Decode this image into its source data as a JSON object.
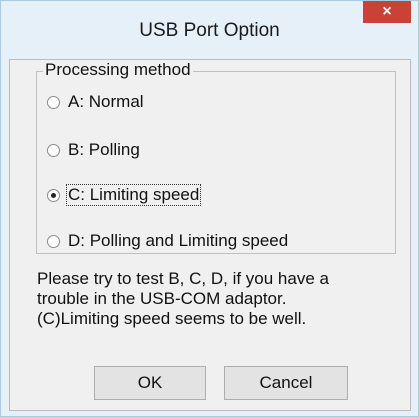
{
  "window": {
    "title": "USB Port Option",
    "close_glyph": "×"
  },
  "processing_method": {
    "legend": "Processing method",
    "options": [
      {
        "label": "A: Normal",
        "selected": false
      },
      {
        "label": "B: Polling",
        "selected": false
      },
      {
        "label": "C: Limiting speed",
        "selected": true
      },
      {
        "label": "D: Polling and Limiting speed",
        "selected": false
      }
    ]
  },
  "note": {
    "line1": "Please try to test B, C, D, if you have a",
    "line2": "trouble in the USB-COM adaptor.",
    "line3": "(C)Limiting speed seems to be well."
  },
  "buttons": {
    "ok": "OK",
    "cancel": "Cancel"
  }
}
